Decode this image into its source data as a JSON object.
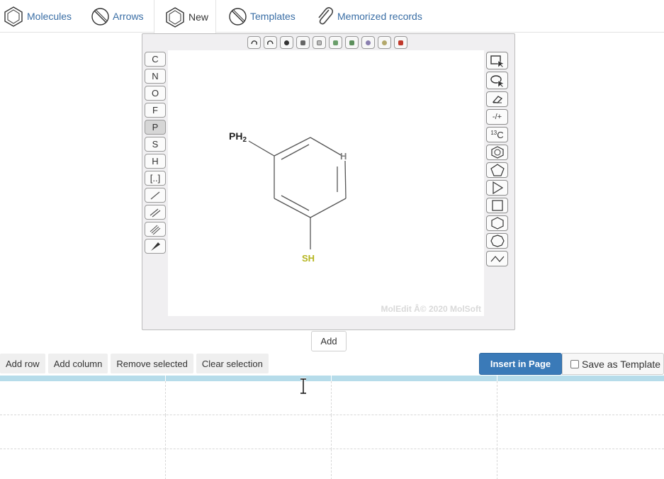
{
  "nav": {
    "tabs": [
      {
        "label": "Molecules",
        "icon": "hexagon-icon"
      },
      {
        "label": "Arrows",
        "icon": "arrows-icon"
      },
      {
        "label": "New",
        "icon": "hexagon-icon"
      },
      {
        "label": "Templates",
        "icon": "templates-icon"
      },
      {
        "label": "Memorized records",
        "icon": "paperclip-icon"
      }
    ],
    "active": "New"
  },
  "editor": {
    "left_tools": [
      "C",
      "N",
      "O",
      "F",
      "P",
      "S",
      "H",
      "[..]"
    ],
    "selected_tool": "P",
    "right_tools": {
      "charge": "-/+",
      "isotope_mass": "13",
      "isotope_symbol": "C"
    },
    "molecule": {
      "substituent_top": "PH",
      "substituent_top_sub": "2",
      "hydrogen": "H",
      "substituent_bottom": "SH"
    },
    "watermark": "MolEdit Â© 2020 MolSoft",
    "colors": {
      "sulfur": "#b5b51f",
      "hydrogen": "#7f7f7f",
      "bond": "#555555"
    }
  },
  "add_button": "Add",
  "table_toolbar": {
    "add_row": "Add row",
    "add_column": "Add column",
    "remove_selected": "Remove selected",
    "clear_selection": "Clear selection"
  },
  "insert_button": "Insert in Page",
  "save_template": {
    "label": "Save as Template",
    "checked": false
  },
  "accent_color": "#3a7ab8"
}
